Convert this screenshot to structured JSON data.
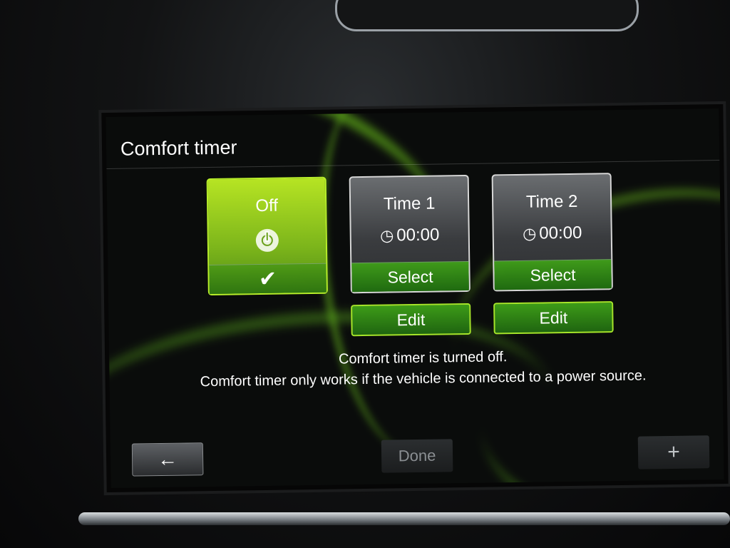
{
  "screen": {
    "title": "Comfort timer"
  },
  "timers": [
    {
      "label": "Off",
      "icon": "power-icon",
      "footer_icon": "checkmark-icon",
      "footer_glyph": "✔",
      "state": "selected"
    },
    {
      "label": "Time 1",
      "icon": "clock-timer-icon",
      "time": "00:00",
      "select_label": "Select",
      "edit_label": "Edit"
    },
    {
      "label": "Time 2",
      "icon": "clock-timer-icon",
      "time": "00:00",
      "select_label": "Select",
      "edit_label": "Edit"
    }
  ],
  "message": {
    "line1": "Comfort timer is turned off.",
    "line2": "Comfort timer only works if the vehicle is connected to a power source."
  },
  "nav": {
    "back_icon": "back-arrow-icon",
    "back_glyph": "←",
    "done_label": "Done",
    "add_icon": "plus-icon",
    "add_glyph": "+"
  },
  "colors": {
    "accent_green": "#7cb51b",
    "button_green": "#2f8014",
    "border_green": "#a6e62a"
  }
}
